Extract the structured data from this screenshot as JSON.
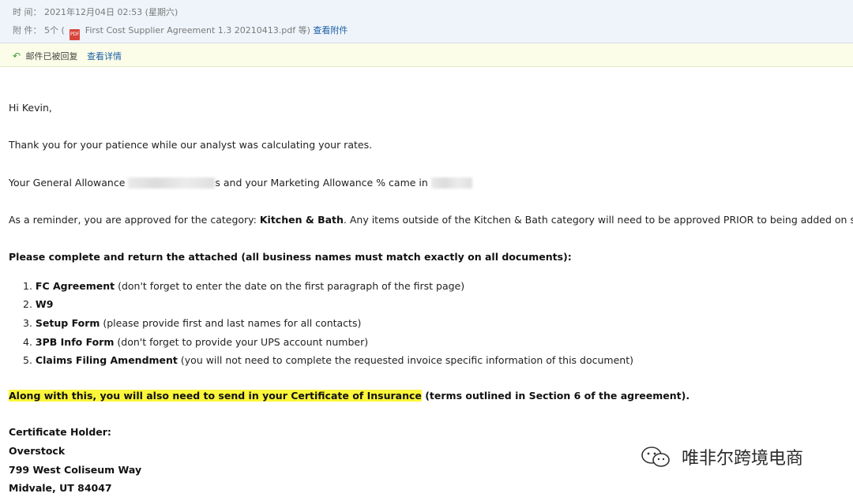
{
  "meta": {
    "time_label": "时 间：",
    "time_value": "2021年12月04日 02:53 (星期六)",
    "attach_label": "附 件：",
    "attach_count": "5个 (",
    "pdf_badge": "PDF",
    "attach_file": "First Cost Supplier Agreement 1.3 20210413.pdf 等)",
    "view_attachments": "查看附件"
  },
  "reply": {
    "status": "邮件已被回复",
    "view_details": "查看详情"
  },
  "body": {
    "greeting": "Hi Kevin,",
    "thanks": "Thank you for your patience while our analyst was calculating your rates.",
    "allowance_a": "Your General Allowance",
    "allowance_b": "s and your Marketing Allowance % came in",
    "reminder_a": "As a reminder, you are approved for the category: ",
    "reminder_bold": "Kitchen & Bath",
    "reminder_b": ".  Any items outside of the Kitchen & Bath category will need to be approved PRIOR to being added on site.",
    "instructions": "Please complete and return the attached (all business names must match exactly on all documents):",
    "items": [
      {
        "num": "1.",
        "bold": "FC Agreement",
        "rest": " (don't forget to enter the date on the first paragraph of the first page)"
      },
      {
        "num": "2.",
        "bold": "W9",
        "rest": ""
      },
      {
        "num": "3.",
        "bold": "Setup Form",
        "rest": " (please provide first and last names for all contacts)"
      },
      {
        "num": "4.",
        "bold": "3PB Info Form",
        "rest": " (don't forget to provide your UPS account number)"
      },
      {
        "num": "5.",
        "bold": " Claims Filing Amendment",
        "rest": " (you will not need to complete the requested invoice specific information of this document)"
      }
    ],
    "insurance_hl": "Along with this, you will also need to send in your Certificate of Insurance",
    "insurance_rest": " (terms outlined in Section 6 of the agreement).",
    "holder_label": "Certificate Holder:",
    "holder_name": "Overstock",
    "holder_street": "799 West Coliseum Way",
    "holder_city": "Midvale, UT 84047"
  },
  "watermark": "唯非尔跨境电商"
}
